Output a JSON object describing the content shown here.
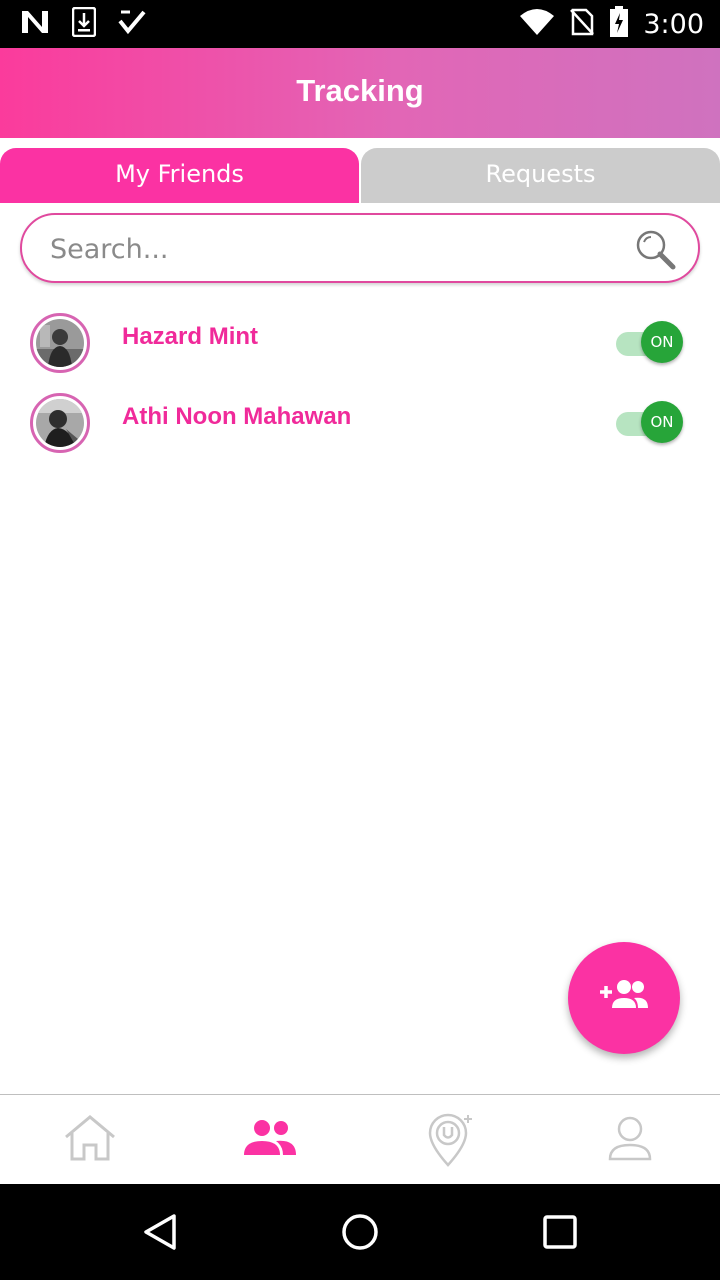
{
  "status_bar": {
    "time": "3:00",
    "left_icons": [
      "n-notification-icon",
      "download-icon",
      "check-icon"
    ],
    "right_icons": [
      "wifi-icon",
      "no-sim-icon",
      "battery-charging-icon"
    ]
  },
  "header": {
    "title": "Tracking"
  },
  "tabs": [
    {
      "label": "My Friends",
      "active": true
    },
    {
      "label": "Requests",
      "active": false
    }
  ],
  "search": {
    "placeholder": "Search...",
    "value": ""
  },
  "friends": [
    {
      "name": "Hazard Mint",
      "tracking": "ON"
    },
    {
      "name": "Athi Noon Mahawan",
      "tracking": "ON"
    }
  ],
  "fab": {
    "icon": "add-friend-icon"
  },
  "bottom_nav": [
    {
      "icon": "home-icon",
      "active": false
    },
    {
      "icon": "friends-icon",
      "active": true
    },
    {
      "icon": "location-pin-icon",
      "active": false
    },
    {
      "icon": "profile-icon",
      "active": false
    }
  ],
  "colors": {
    "accent": "#fb32a3",
    "name_text": "#f02a9a",
    "toggle_on": "#27a539",
    "inactive_tab": "#cccccc"
  }
}
